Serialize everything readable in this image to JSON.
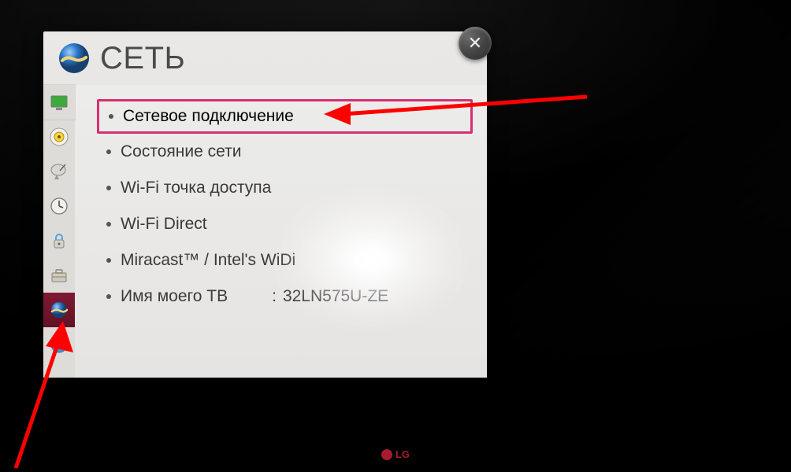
{
  "header": {
    "title": "СЕТЬ",
    "icon": "network-globe-icon",
    "close_label": "✕"
  },
  "sidebar": {
    "items": [
      {
        "name": "picture",
        "icon": "tv-icon"
      },
      {
        "name": "sound",
        "icon": "speaker-icon"
      },
      {
        "name": "satellite",
        "icon": "dish-icon"
      },
      {
        "name": "time",
        "icon": "clock-icon"
      },
      {
        "name": "lock",
        "icon": "lock-icon"
      },
      {
        "name": "general",
        "icon": "briefcase-icon"
      },
      {
        "name": "network",
        "icon": "network-globe-icon",
        "selected": true
      },
      {
        "name": "support",
        "icon": "help-icon"
      }
    ]
  },
  "options": [
    {
      "label": "Сетевое подключение",
      "selected": true
    },
    {
      "label": "Состояние сети"
    },
    {
      "label": "Wi-Fi точка доступа"
    },
    {
      "label": "Wi-Fi Direct"
    },
    {
      "label": "Miracast™ / Intel's WiDi"
    },
    {
      "label": "Имя моего ТВ",
      "value_sep": ":",
      "value": "32LN575U-ZE"
    }
  ],
  "brand": {
    "name": "LG"
  },
  "colors": {
    "highlight_border": "#d72f72",
    "sidebar_selected": "#6d132a",
    "title_text": "#4a4a4a"
  }
}
